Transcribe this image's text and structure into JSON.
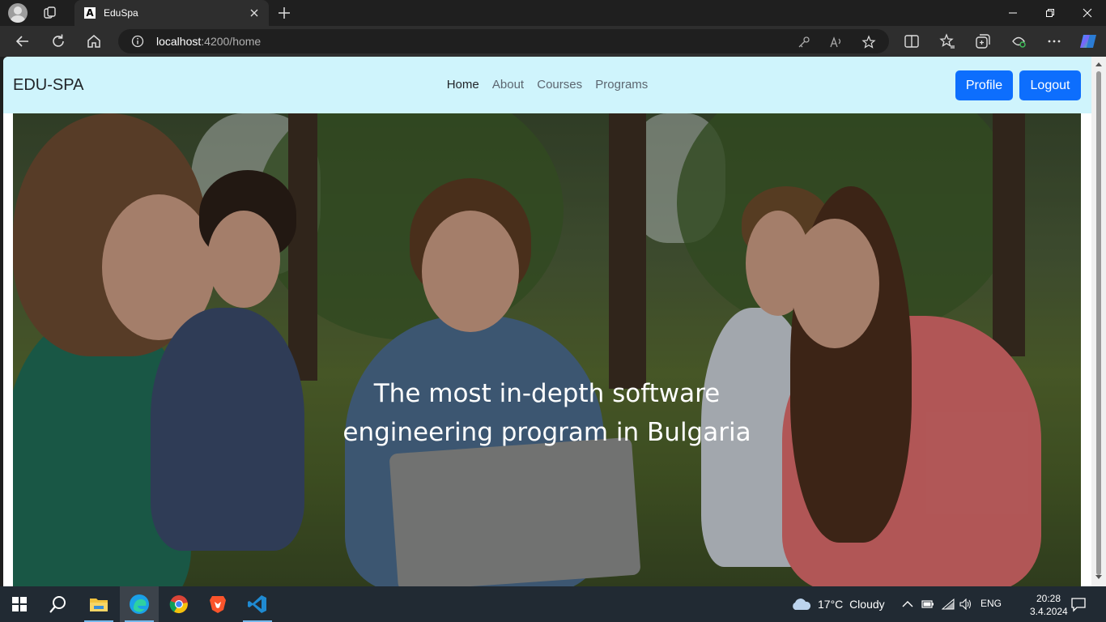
{
  "browser": {
    "tab_title": "EduSpa",
    "tab_favicon_letter": "A",
    "address_host": "localhost",
    "address_rest": ":4200/home"
  },
  "page": {
    "brand": "EDU-SPA",
    "nav": [
      {
        "label": "Home",
        "active": true
      },
      {
        "label": "About",
        "active": false
      },
      {
        "label": "Courses",
        "active": false
      },
      {
        "label": "Programs",
        "active": false
      }
    ],
    "profile_label": "Profile",
    "logout_label": "Logout",
    "hero_text": "The most in-depth software engineering program in Bulgaria",
    "accent_color": "#0d6efd",
    "navbar_color": "#cff4fc"
  },
  "taskbar": {
    "weather_temp": "17°C",
    "weather_desc": "Cloudy",
    "language": "ENG",
    "time": "20:28",
    "date": "3.4.2024 г."
  }
}
